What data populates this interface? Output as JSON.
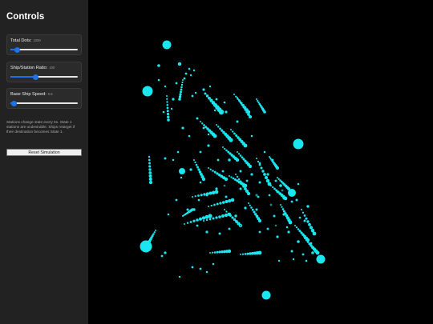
{
  "panel": {
    "title": "Controls",
    "description": "Stations change state every 5s. State 1 stations are undesirable. Ships retarget if their destination becomes State 1.",
    "reset_label": "Reset Simulation"
  },
  "controls": [
    {
      "label": "Total Dots:",
      "value": "1000",
      "fraction": 0.1
    },
    {
      "label": "Ship/Station Ratio:",
      "value": "100",
      "fraction": 0.37
    },
    {
      "label": "Base Ship Speed:",
      "value": "0.5",
      "fraction": 0.05
    }
  ],
  "colors": {
    "dot": "#19e6ee",
    "dim_dot": "#0e8f8f",
    "background": "#000000",
    "panel": "#222222",
    "accent": "#1a73e8"
  }
}
